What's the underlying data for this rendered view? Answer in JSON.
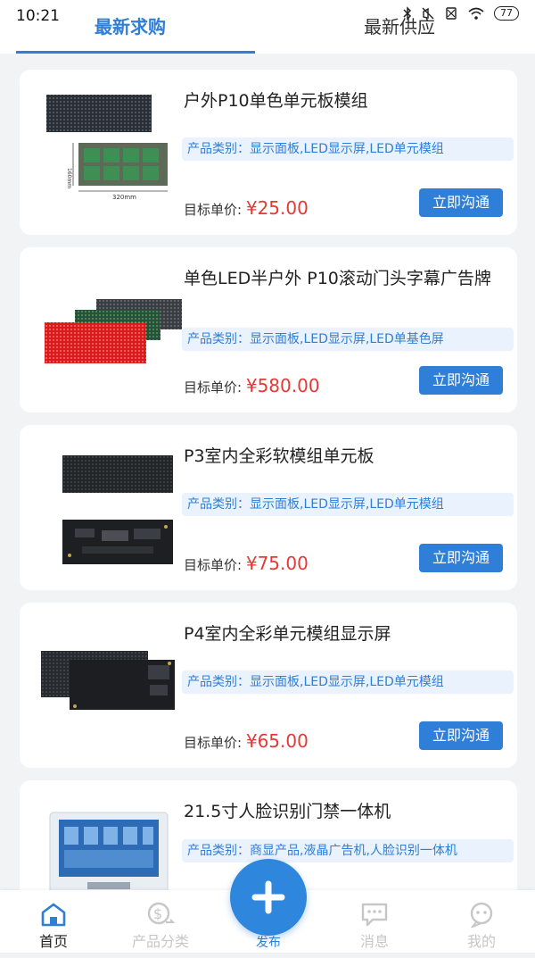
{
  "status": {
    "time": "10:21",
    "battery": "77"
  },
  "tabs": {
    "active": "最新求购",
    "inactive": "最新供应"
  },
  "cards": [
    {
      "title": "户外P10单色单元板模组",
      "tags": "产品类别：显示面板,LED显示屏,LED单元模组",
      "price_label": "目标单价:",
      "price": "¥25.00",
      "button": "立即沟通",
      "dim_w": "320mm",
      "dim_h": "160mm"
    },
    {
      "title": "单色LED半户外 P10滚动门头字幕广告牌",
      "tags": "产品类别：显示面板,LED显示屏,LED单基色屏",
      "price_label": "目标单价:",
      "price": "¥580.00",
      "button": "立即沟通"
    },
    {
      "title": "P3室内全彩软模组单元板",
      "tags": "产品类别：显示面板,LED显示屏,LED单元模组",
      "price_label": "目标单价:",
      "price": "¥75.00",
      "button": "立即沟通"
    },
    {
      "title": "P4室内全彩单元模组显示屏",
      "tags": "产品类别：显示面板,LED显示屏,LED单元模组",
      "price_label": "目标单价:",
      "price": "¥65.00",
      "button": "立即沟通"
    },
    {
      "title": "21.5寸人脸识别门禁一体机",
      "tags": "产品类别：商显产品,液晶广告机,人脸识别一体机"
    }
  ],
  "nav": {
    "home": "首页",
    "category": "产品分类",
    "publish": "发布",
    "messages": "消息",
    "mine": "我的"
  },
  "icons": [
    "bluetooth-icon",
    "mute-icon",
    "sim-icon",
    "wifi-icon",
    "battery-icon",
    "home-icon",
    "category-icon",
    "plus-icon",
    "message-icon",
    "profile-icon"
  ],
  "colors": {
    "accent": "#2f7ed8",
    "price": "#e53935",
    "tag_bg": "#eaf2fd"
  }
}
